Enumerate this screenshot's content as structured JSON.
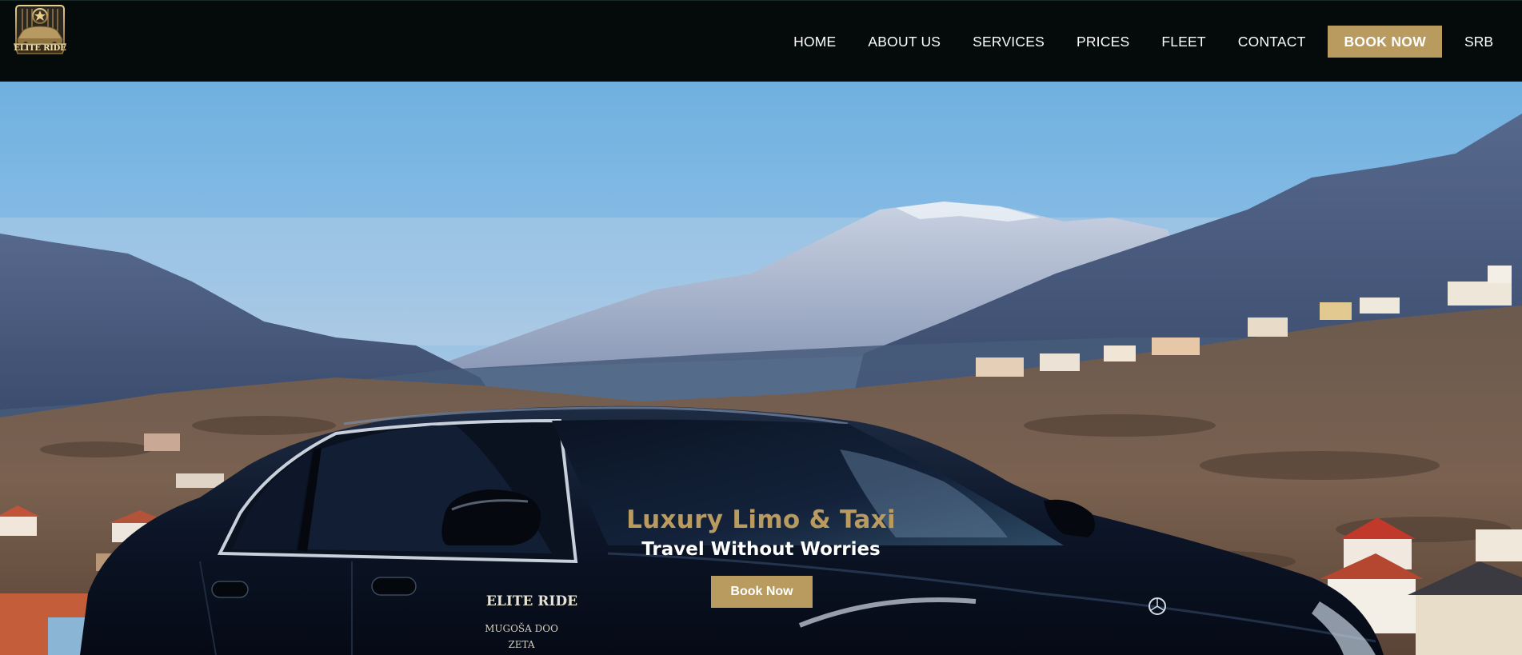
{
  "header": {
    "logo_text": "ELITE RIDE",
    "nav": [
      "HOME",
      "ABOUT US",
      "SERVICES",
      "PRICES",
      "FLEET",
      "CONTACT"
    ],
    "book_label": "BOOK NOW",
    "lang_label": "SRB"
  },
  "hero": {
    "title": "Luxury Limo & Taxi",
    "subtitle": "Travel Without Worries",
    "button_label": "Book Now",
    "door_decal": {
      "brand": "ELITE RIDE",
      "line1": "MUGOŠA DOO",
      "line2": "ZETA"
    }
  },
  "colors": {
    "header_bg": "#050b0a",
    "accent_gold": "#b99a5f",
    "nav_text": "#ffffff"
  },
  "icons": {
    "logo": "car-emblem-logo"
  }
}
